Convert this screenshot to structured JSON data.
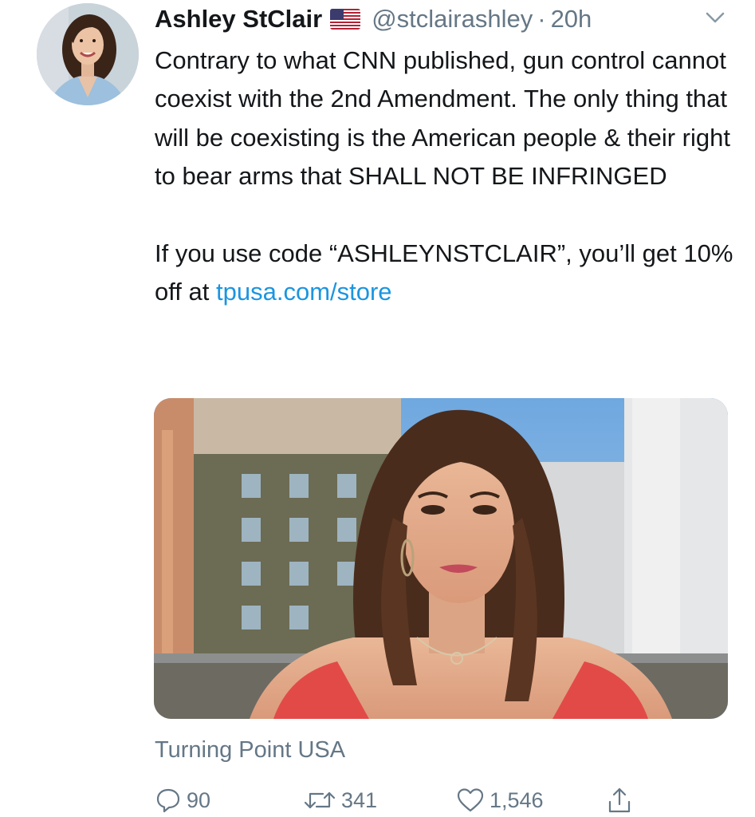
{
  "tweet": {
    "display_name": "Ashley StClair",
    "flag_icon": "us-flag-icon",
    "handle": "@stclairashley",
    "separator": "·",
    "time": "20h",
    "body_text": "Contrary to what CNN published, gun control cannot coexist with the 2nd Amendment. The only thing that will be coexisting is the American people & their right to bear arms that SHALL NOT BE INFRINGED\n\nIf you use code “ASHLEYNSTCLAIR”, you’ll get 10% off at ",
    "link_text": "tpusa.com/store",
    "link_color": "#1b95e0",
    "media_card_source": "Turning Point USA",
    "reply_count": "90",
    "retweet_count": "341",
    "like_count": "1,546"
  },
  "colors": {
    "text_primary": "#14171a",
    "text_secondary": "#657786",
    "accent": "#1b95e0"
  }
}
